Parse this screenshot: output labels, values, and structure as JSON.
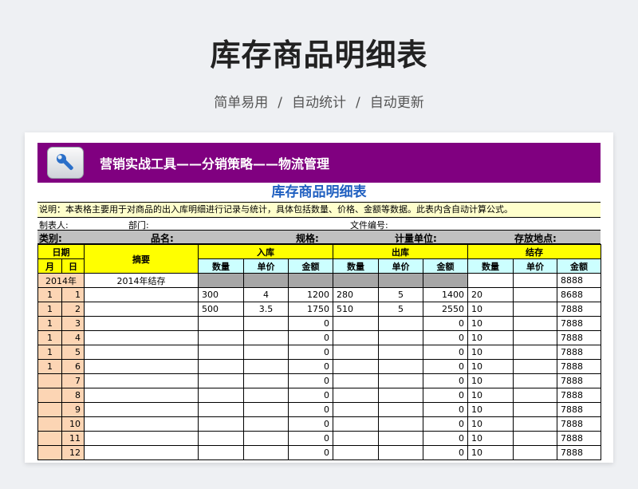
{
  "page": {
    "title": "库存商品明细表",
    "subtitle": [
      "简单易用",
      "自动统计",
      "自动更新"
    ],
    "subtitle_sep": "/"
  },
  "banner": {
    "icon": "wrench-icon",
    "text": "营销实战工具——分销策略——物流管理",
    "color": "#800080"
  },
  "sheet": {
    "title": "库存商品明细表",
    "note": "说明：本表格主要用于对商品的出入库明细进行记录与统计，具体包括数量、价格、金额等数据。此表内含自动计算公式。",
    "meta": {
      "maker": "制表人:",
      "dept": "部门:",
      "file_no": "文件编号:"
    },
    "category_row": {
      "category": "类别:",
      "name": "品名:",
      "spec": "规格:",
      "unit": "计量单位:",
      "location": "存放地点:"
    },
    "headers": {
      "date": "日期",
      "month": "月",
      "day": "日",
      "summary": "摘要",
      "in": "入库",
      "out": "出库",
      "balance": "结存",
      "qty": "数量",
      "price": "单价",
      "amount": "金额"
    },
    "carry_row": {
      "year": "2014年",
      "summary": "2014年结存",
      "bal_amount": "8888"
    },
    "rows": [
      {
        "month": "1",
        "day": "1",
        "in_qty": "300",
        "in_price": "4",
        "in_amt": "1200",
        "out_qty": "280",
        "out_price": "5",
        "out_amt": "1400",
        "bal_qty": "20",
        "bal_amt": "8688"
      },
      {
        "month": "1",
        "day": "2",
        "in_qty": "500",
        "in_price": "3.5",
        "in_amt": "1750",
        "out_qty": "510",
        "out_price": "5",
        "out_amt": "2550",
        "bal_qty": "10",
        "bal_amt": "7888"
      },
      {
        "month": "1",
        "day": "3",
        "in_amt": "0",
        "out_amt": "0",
        "bal_qty": "10",
        "bal_amt": "7888"
      },
      {
        "month": "1",
        "day": "4",
        "in_amt": "0",
        "out_amt": "0",
        "bal_qty": "10",
        "bal_amt": "7888"
      },
      {
        "month": "1",
        "day": "5",
        "in_amt": "0",
        "out_amt": "0",
        "bal_qty": "10",
        "bal_amt": "7888"
      },
      {
        "month": "1",
        "day": "6",
        "in_amt": "0",
        "out_amt": "0",
        "bal_qty": "10",
        "bal_amt": "7888"
      },
      {
        "month": "",
        "day": "7",
        "in_amt": "0",
        "out_amt": "0",
        "bal_qty": "10",
        "bal_amt": "7888"
      },
      {
        "month": "",
        "day": "8",
        "in_amt": "0",
        "out_amt": "0",
        "bal_qty": "10",
        "bal_amt": "7888"
      },
      {
        "month": "",
        "day": "9",
        "in_amt": "0",
        "out_amt": "0",
        "bal_qty": "10",
        "bal_amt": "7888"
      },
      {
        "month": "",
        "day": "10",
        "in_amt": "0",
        "out_amt": "0",
        "bal_qty": "10",
        "bal_amt": "7888"
      },
      {
        "month": "",
        "day": "11",
        "in_amt": "0",
        "out_amt": "0",
        "bal_qty": "10",
        "bal_amt": "7888"
      },
      {
        "month": "",
        "day": "12",
        "in_amt": "0",
        "out_amt": "0",
        "bal_qty": "10",
        "bal_amt": "7888"
      }
    ]
  }
}
